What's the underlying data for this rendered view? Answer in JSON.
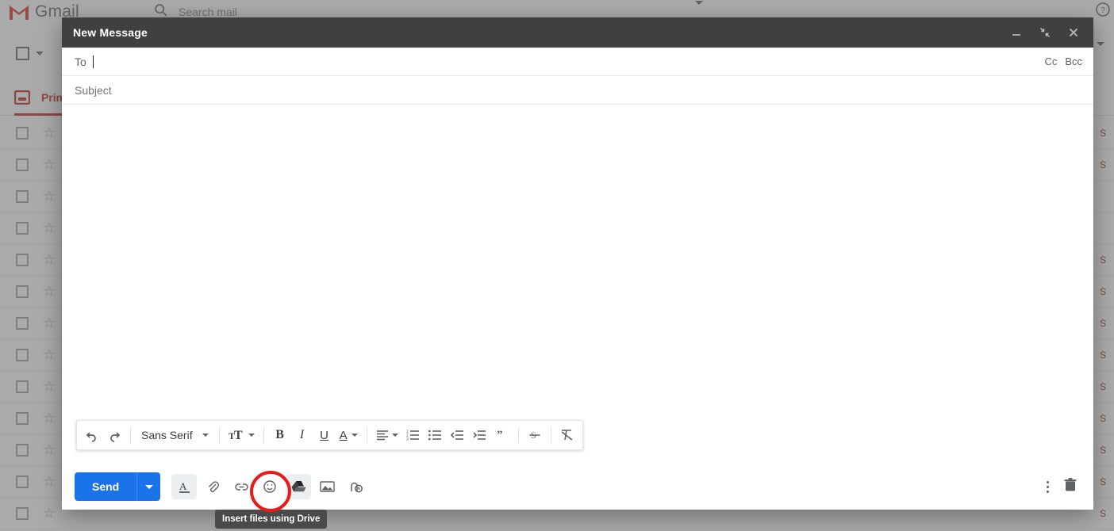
{
  "background": {
    "brand": "Gmail",
    "search_placeholder": "Search mail",
    "search_icon": "search-icon",
    "help_icon": "help-icon",
    "primary_tab": "Primary",
    "rows": [
      {
        "sender": "",
        "subject": "",
        "date": "S"
      },
      {
        "sender": "",
        "subject": "",
        "date": "S"
      },
      {
        "sender": "",
        "subject": "",
        "date": ""
      },
      {
        "sender": "",
        "subject": "",
        "date": ""
      },
      {
        "sender": "",
        "subject": "",
        "date": "S"
      },
      {
        "sender": "",
        "subject": "",
        "date": "S"
      },
      {
        "sender": "",
        "subject": "",
        "date": "S"
      },
      {
        "sender": "",
        "subject": "",
        "date": "S"
      },
      {
        "sender": "",
        "subject": "",
        "date": "S"
      },
      {
        "sender": "",
        "subject": "",
        "date": "S"
      },
      {
        "sender": "",
        "subject": "",
        "date": "S"
      },
      {
        "sender": "",
        "subject": "",
        "date": "S"
      },
      {
        "sender": "",
        "subject": "",
        "date": "S"
      }
    ]
  },
  "compose": {
    "title": "New Message",
    "window_buttons": [
      {
        "name": "minimize-button",
        "glyph": "minimize-icon"
      },
      {
        "name": "exit-fullscreen-button",
        "glyph": "exit-fullscreen-icon"
      },
      {
        "name": "close-button",
        "glyph": "close-icon"
      }
    ],
    "to_label": "To",
    "to_value": "",
    "cc_label": "Cc",
    "bcc_label": "Bcc",
    "subject_placeholder": "Subject",
    "subject_value": "",
    "body_value": ""
  },
  "format_toolbar": {
    "undo": "undo-icon",
    "redo": "redo-icon",
    "font_name": "Sans Serif",
    "size_label": "text-size-icon",
    "bold": "B",
    "italic": "I",
    "underline": "U",
    "text_color": "A",
    "align": "align-icon",
    "numbered_list": "numbered-list-icon",
    "bulleted_list": "bulleted-list-icon",
    "indent_less": "indent-less-icon",
    "indent_more": "indent-more-icon",
    "quote": "”",
    "strikethrough": "strikethrough-icon",
    "remove_format": "remove-formatting-icon"
  },
  "action_bar": {
    "send_label": "Send",
    "send_more": "send-options-icon",
    "icons": [
      {
        "name": "formatting-options-icon",
        "label": "A",
        "active": true
      },
      {
        "name": "attach-file-icon",
        "label": "attach",
        "active": false
      },
      {
        "name": "insert-link-icon",
        "label": "link",
        "active": false
      },
      {
        "name": "insert-emoji-icon",
        "label": "emoji",
        "active": false
      },
      {
        "name": "insert-drive-icon",
        "label": "drive",
        "active": true
      },
      {
        "name": "insert-photo-icon",
        "label": "photo",
        "active": false
      },
      {
        "name": "confidential-mode-icon",
        "label": "clock",
        "active": false
      }
    ],
    "more_options": "more-options-icon",
    "discard": "discard-draft-icon"
  },
  "annotation": {
    "tooltip_text": "Insert files using Drive",
    "highlight_color": "#e81b1b",
    "target": "insert-drive-icon"
  },
  "colors": {
    "accent_blue": "#1a73e8",
    "header_gray": "#404040",
    "gmail_red": "#c5221f"
  }
}
